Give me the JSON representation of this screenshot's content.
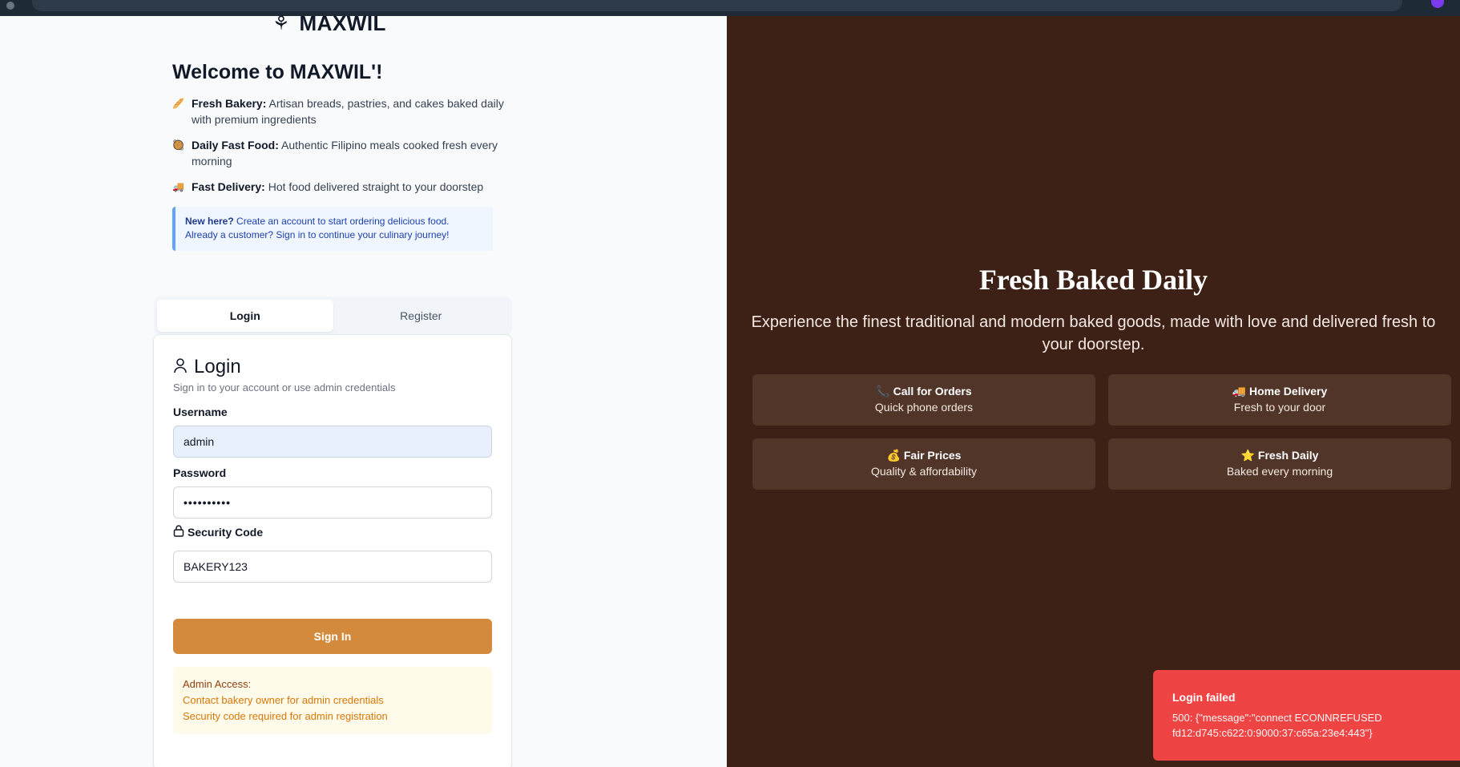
{
  "brand": {
    "name": "MAXWIL",
    "logo_icon": "wheat-icon"
  },
  "welcome": {
    "title": "Welcome to MAXWIL'!",
    "features": [
      {
        "icon": "bread-icon",
        "title": "Fresh Bakery:",
        "text": "Artisan breads, pastries, and cakes baked daily with premium ingredients"
      },
      {
        "icon": "bowl-icon",
        "title": "Daily Fast Food:",
        "text": "Authentic Filipino meals cooked fresh every morning"
      },
      {
        "icon": "truck-icon",
        "title": "Fast Delivery:",
        "text": "Hot food delivered straight to your doorstep"
      }
    ],
    "note": {
      "strong": "New here?",
      "line1": "Create an account to start ordering delicious food.",
      "line2": "Already a customer? Sign in to continue your culinary journey!"
    }
  },
  "tabs": [
    {
      "label": "Login",
      "active": true
    },
    {
      "label": "Register",
      "active": false
    }
  ],
  "login": {
    "title": "Login",
    "subtitle": "Sign in to your account or use admin credentials",
    "username_label": "Username",
    "username_value": "admin",
    "password_label": "Password",
    "password_value": "••••••••••",
    "security_label": "Security Code",
    "security_value": "BAKERY123",
    "submit_label": "Sign In",
    "admin": {
      "heading": "Admin Access:",
      "line1": "Contact bakery owner for admin credentials",
      "line2": "Security code required for admin registration"
    }
  },
  "hero": {
    "title": "Fresh Baked Daily",
    "subtitle": "Experience the finest traditional and modern baked goods, made with love and delivered fresh to your doorstep.",
    "tiles": [
      {
        "icon": "phone-icon",
        "glyph": "📞",
        "title": "Call for Orders",
        "sub": "Quick phone orders"
      },
      {
        "icon": "truck-icon",
        "glyph": "🚚",
        "title": "Home Delivery",
        "sub": "Fresh to your door"
      },
      {
        "icon": "money-bag-icon",
        "glyph": "💰",
        "title": "Fair Prices",
        "sub": "Quality & affordability"
      },
      {
        "icon": "star-icon",
        "glyph": "⭐",
        "title": "Fresh Daily",
        "sub": "Baked every morning"
      }
    ]
  },
  "toast": {
    "title": "Login failed",
    "message": "500: {\"message\":\"connect ECONNREFUSED fd12:d745:c622:0:9000:37:c65a:23e4:443\"}"
  },
  "colors": {
    "accent": "#d48a3c",
    "hero_bg": "#3d2117",
    "tile_bg": "#523529",
    "error": "#ef4444",
    "note_border": "#60a5fa"
  }
}
